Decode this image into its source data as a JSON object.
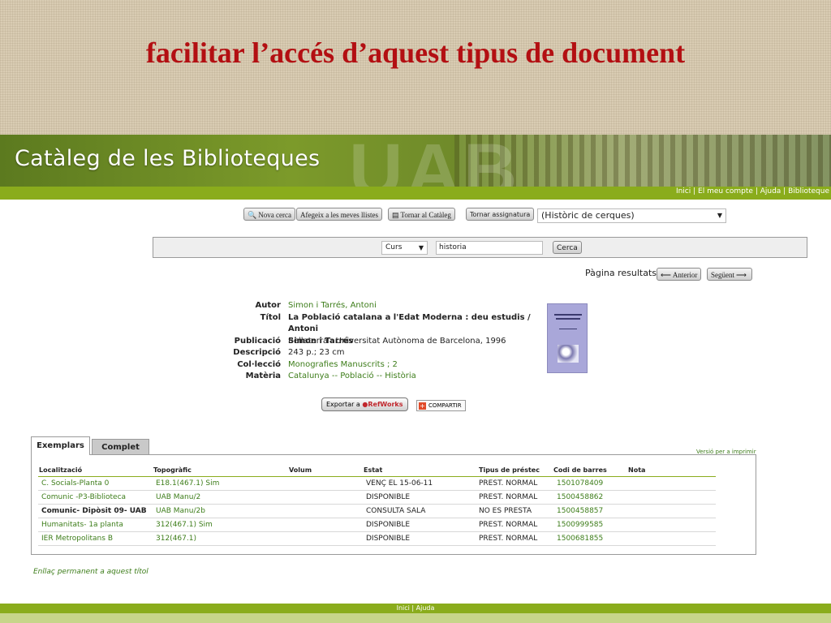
{
  "slide": {
    "title": "facilitar l’accés d’aquest tipus de document"
  },
  "header": {
    "catalog_title": "Catàleg de les Biblioteques",
    "bg_letters": "UAB",
    "nav_links": [
      "Inici",
      "El meu compte",
      "Ajuda",
      "Biblioteque"
    ]
  },
  "toolbar": {
    "nova_cerca": "Nova cerca",
    "afegeix": "Afegeix a les meves llistes",
    "tornar_cataleg": "Tornar al Catàleg",
    "tornar_assignatura": "Tornar assignatura",
    "historic_select": "(Històric de cerques)"
  },
  "search": {
    "field_select": "Curs",
    "query_value": "historia",
    "submit_label": "Cerca"
  },
  "pager": {
    "label": "Pàgina resultats:",
    "prev": "Anterior",
    "next": "Següent"
  },
  "record": {
    "labels": {
      "autor": "Autor",
      "titol": "Títol",
      "publicacio": "Publicació",
      "descripcio": "Descripció",
      "colleccio": "Col·lecció",
      "materia": "Matèria"
    },
    "autor": "Simon i Tarrés, Antoni",
    "titol_line1": "La Població catalana a l'Edat Moderna : deu estudis / Antoni",
    "titol_line2": "Simon i Tarrés",
    "publicacio": "Bellaterra : Universitat Autònoma de Barcelona, 1996",
    "descripcio": "243 p.; 23 cm",
    "colleccio": "Monografies Manuscrits ; 2",
    "materia": "Catalunya -- Població -- Història"
  },
  "actions": {
    "export_prefix": "Exportar a",
    "export_brand": "RefWorks",
    "share": "COMPARTIR"
  },
  "tabs": {
    "exemplars": "Exemplars",
    "complet": "Complet",
    "print": "Versió per a imprimir"
  },
  "table": {
    "headers": [
      "Localització",
      "Topogràfic",
      "Volum",
      "Estat",
      "Tipus de préstec",
      "Codi de barres",
      "Nota"
    ],
    "rows": [
      {
        "loc": "C. Socials-Planta 0",
        "top": "E18.1(467.1) Sim",
        "estat": "VENÇ EL 15-06-11",
        "tipus": "PREST. NORMAL",
        "codi": "1501078409"
      },
      {
        "loc": "Comunic -P3-Biblioteca",
        "top": "UAB Manu/2",
        "estat": "DISPONIBLE",
        "tipus": "PREST. NORMAL",
        "codi": "1500458862"
      },
      {
        "loc": "Comunic- Dipòsit 09- UAB",
        "top": "UAB Manu/2b",
        "estat": "CONSULTA SALA",
        "tipus": "NO ES PRESTA",
        "codi": "1500458857"
      },
      {
        "loc": "Humanitats- 1a planta",
        "top": "312(467.1) Sim",
        "estat": "DISPONIBLE",
        "tipus": "PREST. NORMAL",
        "codi": "1500999585"
      },
      {
        "loc": "IER Metropolitans B",
        "top": "312(467.1)",
        "estat": "DISPONIBLE",
        "tipus": "PREST. NORMAL",
        "codi": "1500681855"
      }
    ]
  },
  "permalink": "Enllaç permanent a aquest títol",
  "footer": {
    "text": "Inici | Ajuda"
  }
}
